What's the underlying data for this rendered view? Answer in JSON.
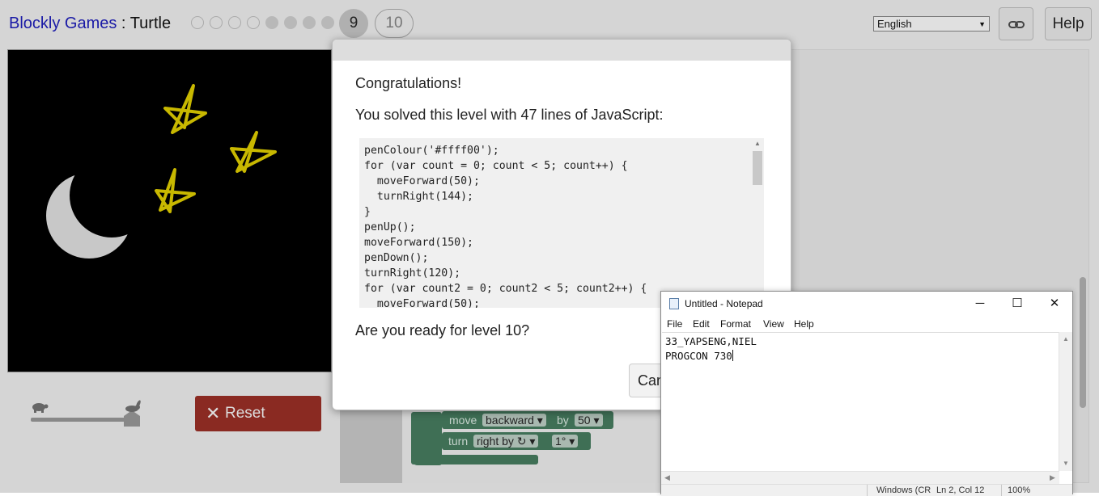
{
  "header": {
    "app_link": "Blockly Games",
    "separator": " : ",
    "game": "Turtle",
    "levels_done": 7,
    "current_level": "9",
    "next_level": "10",
    "language": "English",
    "link_icon": "link-icon",
    "help_label": "Help"
  },
  "dialog": {
    "congrats": "Congratulations!",
    "solved_text": "You solved this level with 47 lines of JavaScript:",
    "code_lines": [
      "penColour('#ffff00');",
      "for (var count = 0; count < 5; count++) {",
      "  moveForward(50);",
      "  turnRight(144);",
      "}",
      "penUp();",
      "moveForward(150);",
      "penDown();",
      "turnRight(120);",
      "for (var count2 = 0; count2 < 5; count2++) {",
      "  moveForward(50);"
    ],
    "ready_text": "Are you ready for level 10?",
    "cancel_label": "Cancel"
  },
  "controls": {
    "reset_label": "Reset",
    "slow_icon": "turtle-icon",
    "fast_icon": "rabbit-icon"
  },
  "blocks": [
    {
      "keyword": "move",
      "dropdown": "backward",
      "by": "by",
      "value": "50"
    },
    {
      "keyword": "turn",
      "dropdown": "right by ↻",
      "value": "1°"
    }
  ],
  "notepad": {
    "title": "Untitled - Notepad",
    "menu": [
      "File",
      "Edit",
      "Format",
      "View",
      "Help"
    ],
    "text_lines": [
      "33_YAPSENG,NIEL",
      "PROGCON 730"
    ],
    "status_left": "Windows (CR",
    "status_mid": "Ln 2, Col 12",
    "status_zoom": "100%"
  },
  "colors": {
    "star": "#c8b800",
    "moon": "#c8c8c8",
    "reset_bg": "#8a2a22",
    "block": "#3f6f55"
  }
}
